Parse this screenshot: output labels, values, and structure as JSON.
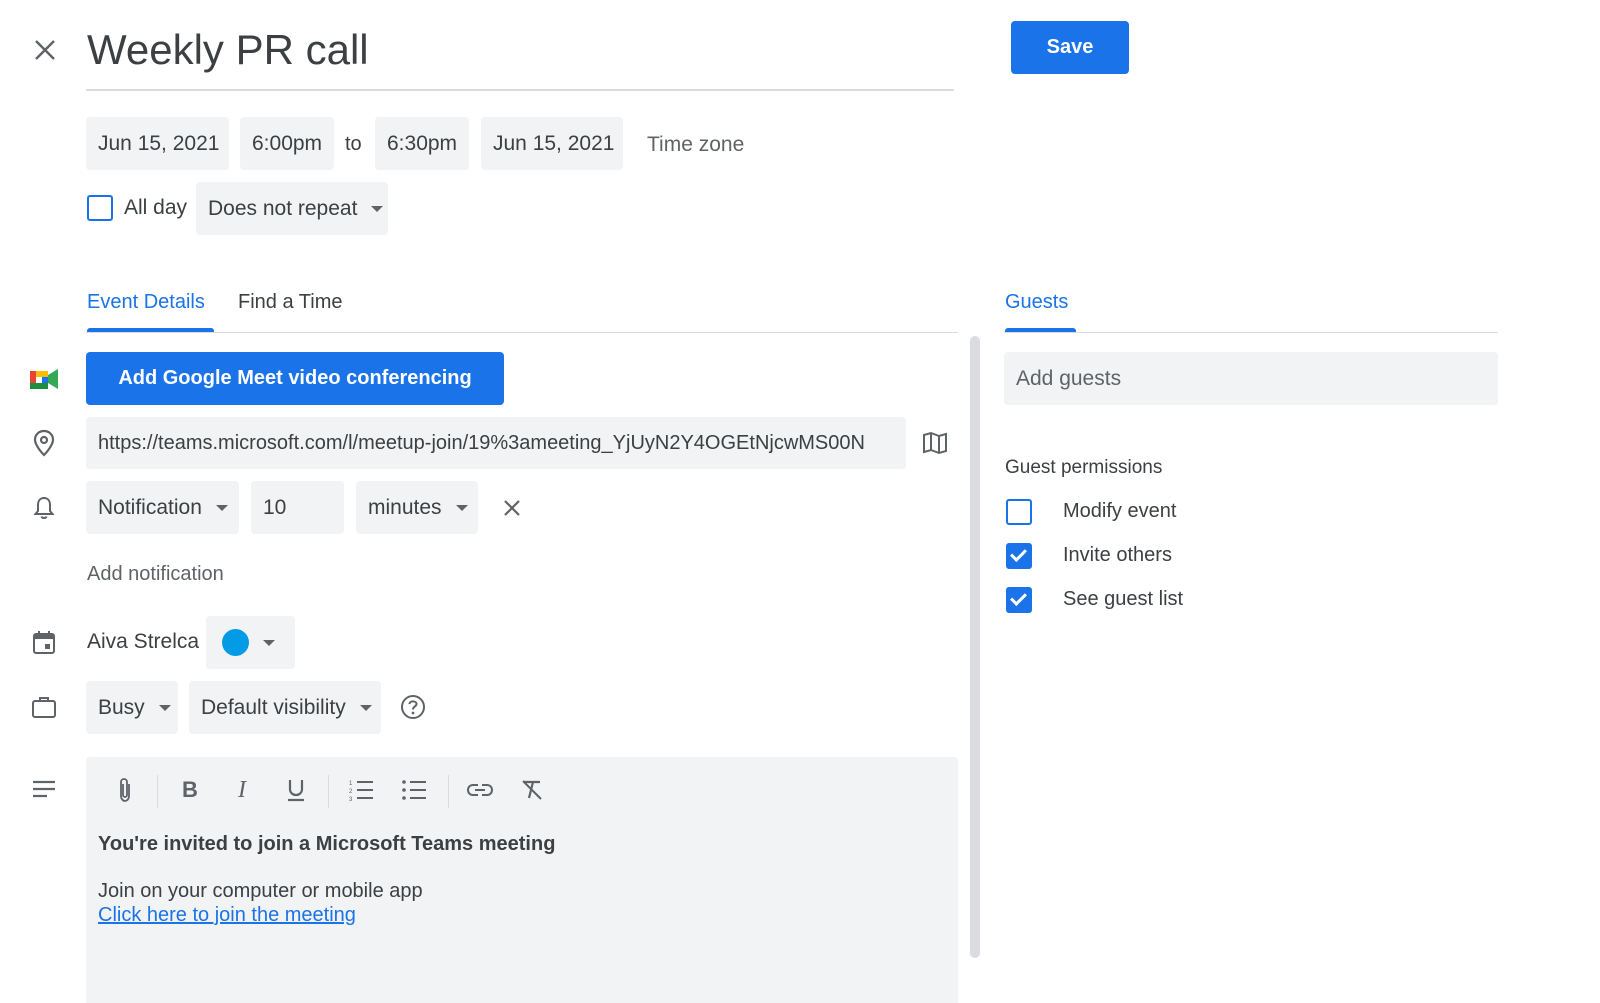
{
  "header": {
    "title": "Weekly PR call",
    "save_label": "Save"
  },
  "datetime": {
    "start_date": "Jun 15, 2021",
    "start_time": "6:00pm",
    "to_label": "to",
    "end_time": "6:30pm",
    "end_date": "Jun 15, 2021",
    "timezone_label": "Time zone",
    "all_day_label": "All day",
    "all_day_checked": false,
    "repeat_value": "Does not repeat"
  },
  "tabs": {
    "event_details": "Event Details",
    "find_time": "Find a Time",
    "guests": "Guests"
  },
  "details": {
    "meet_button_label": "Add Google Meet video conferencing",
    "location_value": "https://teams.microsoft.com/l/meetup-join/19%3ameeting_YjUyN2Y4OGEtNjcwMS00N",
    "notification_type": "Notification",
    "notification_amount": "10",
    "notification_unit": "minutes",
    "add_notification_label": "Add notification",
    "calendar_owner": "Aiva Strelca",
    "calendar_color": "#039be5",
    "availability": "Busy",
    "visibility": "Default visibility"
  },
  "description": {
    "heading": "You're invited to join a Microsoft Teams meeting",
    "line1": "Join on your computer or mobile app",
    "link_text": "Click here to join the meeting"
  },
  "guests": {
    "add_placeholder": "Add guests",
    "permissions_title": "Guest permissions",
    "permissions": [
      {
        "label": "Modify event",
        "checked": false
      },
      {
        "label": "Invite others",
        "checked": true
      },
      {
        "label": "See guest list",
        "checked": true
      }
    ]
  },
  "colors": {
    "accent": "#1a73e8",
    "field_bg": "#f1f3f4"
  }
}
